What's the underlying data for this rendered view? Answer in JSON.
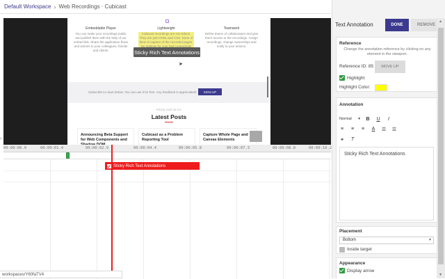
{
  "breadcrumb": {
    "workspace": "Default Workspace",
    "separator": "›",
    "current": "Web Recordings · Cubicast"
  },
  "viewport": {
    "features": [
      {
        "title": "Embeddable Player",
        "text": "You can make your recordings public and publish them with the help of our embed link. Share the application flows and actions to your colleagues, friends and clients."
      },
      {
        "title": "Lightweight",
        "text": "Cubicast recordings are not videos. They are just HTML and CSS. None of them is capture of the recorded pages. No settings for your bad connectivity and time."
      },
      {
        "title": "Teamwork",
        "text": "Define teams of collaborators and give them access to the recordings. Assign recordings, change ownerships and notify to your actions."
      }
    ],
    "tooltip": "Sticky Rich Text Annotations",
    "banner_text": "Subscribe to news below. You can use it for free. Any feedback is appreciated!",
    "signup": "SIGN UP",
    "blog_eyebrow": "FROM OUR BLOG",
    "blog_title": "Latest Posts",
    "posts": [
      {
        "title": "Announcing Beta Support for Web Components and Shadow DOM",
        "date": ""
      },
      {
        "title": "Cubicast as a Problem Reporting Tool",
        "date": ""
      },
      {
        "title": "Capture Whole Page and Canvas Elements",
        "date": ""
      }
    ]
  },
  "timeline": {
    "ticks": [
      "00:00:00.0",
      "00:00:01.4",
      "00:00:02.9",
      "00:00:04.4",
      "00:00:05.8",
      "00:00:07.3",
      "00:00:08.8",
      "00:00:10.2"
    ],
    "annotation_label": "Sticky Rich Text Annotations",
    "status_url": "workspaces/Y60faTV4"
  },
  "panel": {
    "title": "Text Annotation",
    "done": "DONE",
    "remove": "REMOVE",
    "reference": {
      "heading": "Reference",
      "description": "Change the annotation reference by clicking on any element in the viewport.",
      "ref_id": "Reference ID: 85",
      "move_up": "MOVE UP",
      "highlight_label": "Highlight",
      "highlight_color_label": "Highlight Color:",
      "highlight_color": "#ffff00"
    },
    "annotation": {
      "heading": "Annotation",
      "format": "Normal",
      "content": "Sticky Rich Text Annotations"
    },
    "placement": {
      "heading": "Placement",
      "value": "Bottom",
      "inside_target": "Inside target"
    },
    "appearance": {
      "heading": "Appearance",
      "display_arrow": "Display arrow"
    }
  },
  "colors": {
    "accent": "#3b3a8e",
    "annotation_red": "#ee1c1c",
    "check_green": "#2f9a40"
  }
}
